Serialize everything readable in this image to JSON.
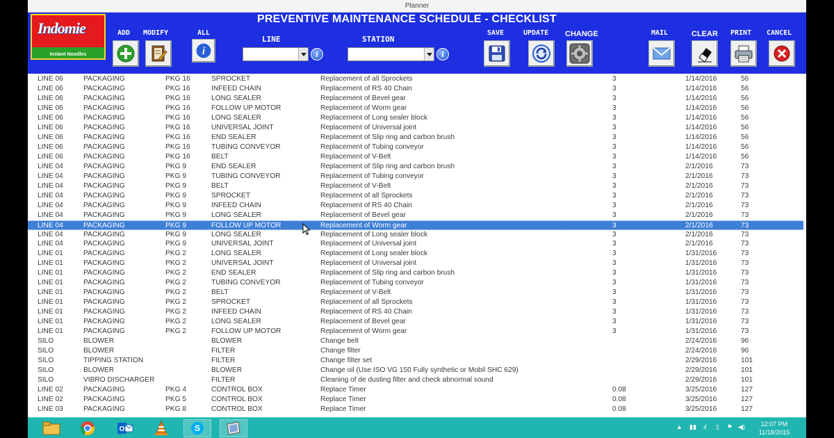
{
  "window": {
    "title": "Planner"
  },
  "header": {
    "app_title": "PREVENTIVE MAINTENANCE SCHEDULE - CHECKLIST",
    "logo_brand": "Indomie",
    "logo_sub": "Instant Noodles",
    "labels": {
      "add": "ADD",
      "modify": "MODIFY",
      "all": "ALL",
      "line": "LINE",
      "station": "STATION",
      "save": "SAVE",
      "update": "UPDATE",
      "change": "CHANGE",
      "mail": "MAIL",
      "clear": "CLEAR",
      "print": "PRINT",
      "cancel": "CANCEL"
    },
    "line_value": "",
    "station_value": ""
  },
  "accent_colors": {
    "toolbar": "#1d2fe0",
    "selection": "#3e7fd6",
    "taskbar": "#21b5b0"
  },
  "rows": [
    [
      "LINE 06",
      "PACKAGING",
      "PKG 16",
      "SPROCKET",
      "Replacement of all Sprockets",
      "3",
      "1/14/2016",
      "56"
    ],
    [
      "LINE 06",
      "PACKAGING",
      "PKG 16",
      "INFEED CHAIN",
      "Replacement of RS 40 Chain",
      "3",
      "1/14/2016",
      "56"
    ],
    [
      "LINE 06",
      "PACKAGING",
      "PKG 16",
      "LONG SEALER",
      "Replacement of Bevel gear",
      "3",
      "1/14/2016",
      "56"
    ],
    [
      "LINE 06",
      "PACKAGING",
      "PKG 16",
      "FOLLOW UP MOTOR",
      "Replacement of Worm gear",
      "3",
      "1/14/2016",
      "56"
    ],
    [
      "LINE 06",
      "PACKAGING",
      "PKG 16",
      "LONG SEALER",
      "Replacement of Long sealer block",
      "3",
      "1/14/2016",
      "56"
    ],
    [
      "LINE 06",
      "PACKAGING",
      "PKG 16",
      "UNIVERSAL JOINT",
      "Replacement of Universal joint",
      "3",
      "1/14/2016",
      "56"
    ],
    [
      "LINE 06",
      "PACKAGING",
      "PKG 16",
      "END SEALER",
      "Replacement of Slip ring and carbon brush",
      "3",
      "1/14/2016",
      "56"
    ],
    [
      "LINE 06",
      "PACKAGING",
      "PKG 16",
      "TUBING CONVEYOR",
      "Replacement of Tubing conveyor",
      "3",
      "1/14/2016",
      "56"
    ],
    [
      "LINE 06",
      "PACKAGING",
      "PKG 16",
      "BELT",
      "Replacement of V-Belt",
      "3",
      "1/14/2016",
      "56"
    ],
    [
      "LINE 04",
      "PACKAGING",
      "PKG 9",
      "END SEALER",
      "Replacement of Slip ring and carbon brush",
      "3",
      "2/1/2016",
      "73"
    ],
    [
      "LINE 04",
      "PACKAGING",
      "PKG 9",
      "TUBING CONVEYOR",
      "Replacement of Tubing conveyor",
      "3",
      "2/1/2016",
      "73"
    ],
    [
      "LINE 04",
      "PACKAGING",
      "PKG 9",
      "BELT",
      "Replacement of V-Belt",
      "3",
      "2/1/2016",
      "73"
    ],
    [
      "LINE 04",
      "PACKAGING",
      "PKG 9",
      "SPROCKET",
      "Replacement of all Sprockets",
      "3",
      "2/1/2016",
      "73"
    ],
    [
      "LINE 04",
      "PACKAGING",
      "PKG 9",
      "INFEED CHAIN",
      "Replacement of RS 40 Chain",
      "3",
      "2/1/2016",
      "73"
    ],
    [
      "LINE 04",
      "PACKAGING",
      "PKG 9",
      "LONG SEALER",
      "Replacement of Bevel gear",
      "3",
      "2/1/2016",
      "73"
    ],
    [
      "LINE 04",
      "PACKAGING",
      "PKG 9",
      "FOLLOW UP MOTOR",
      "Replacement of Worm gear",
      "3",
      "2/1/2016",
      "73"
    ],
    [
      "LINE 04",
      "PACKAGING",
      "PKG 9",
      "LONG SEALER",
      "Replacement of Long sealer block",
      "3",
      "2/1/2016",
      "73"
    ],
    [
      "LINE 04",
      "PACKAGING",
      "PKG 9",
      "UNIVERSAL JOINT",
      "Replacement of Universal joint",
      "3",
      "2/1/2016",
      "73"
    ],
    [
      "LINE 01",
      "PACKAGING",
      "PKG 2",
      "LONG SEALER",
      "Replacement of Long sealer block",
      "3",
      "1/31/2016",
      "73"
    ],
    [
      "LINE 01",
      "PACKAGING",
      "PKG 2",
      "UNIVERSAL JOINT",
      "Replacement of Universal joint",
      "3",
      "1/31/2016",
      "73"
    ],
    [
      "LINE 01",
      "PACKAGING",
      "PKG 2",
      "END SEALER",
      "Replacement of Slip ring and carbon brush",
      "3",
      "1/31/2016",
      "73"
    ],
    [
      "LINE 01",
      "PACKAGING",
      "PKG 2",
      "TUBING CONVEYOR",
      "Replacement of Tubing conveyor",
      "3",
      "1/31/2016",
      "73"
    ],
    [
      "LINE 01",
      "PACKAGING",
      "PKG 2",
      "BELT",
      "Replacement of V-Belt",
      "3",
      "1/31/2016",
      "73"
    ],
    [
      "LINE 01",
      "PACKAGING",
      "PKG 2",
      "SPROCKET",
      "Replacement of all Sprockets",
      "3",
      "1/31/2016",
      "73"
    ],
    [
      "LINE 01",
      "PACKAGING",
      "PKG 2",
      "INFEED CHAIN",
      "Replacement of RS 40 Chain",
      "3",
      "1/31/2016",
      "73"
    ],
    [
      "LINE 01",
      "PACKAGING",
      "PKG 2",
      "LONG SEALER",
      "Replacement of Bevel gear",
      "3",
      "1/31/2016",
      "73"
    ],
    [
      "LINE 01",
      "PACKAGING",
      "PKG 2",
      "FOLLOW UP MOTOR",
      "Replacement of Worm gear",
      "3",
      "1/31/2016",
      "73"
    ],
    [
      "SILO",
      "BLOWER",
      "",
      "BLOWER",
      "Change belt",
      "",
      "2/24/2016",
      "96"
    ],
    [
      "SILO",
      "BLOWER",
      "",
      "FILTER",
      "Change filter",
      "",
      "2/24/2016",
      "96"
    ],
    [
      "SILO",
      "TIPPING STATION",
      "",
      "FILTER",
      "Change filter set",
      "",
      "2/29/2016",
      "101"
    ],
    [
      "SILO",
      "BLOWER",
      "",
      "BLOWER",
      "Change oil (Use ISO VG 150 Fully synthetic or Mobil SHC 629)",
      "",
      "2/29/2016",
      "101"
    ],
    [
      "SILO",
      "VIBRO DISCHARGER",
      "",
      "FILTER",
      "Cleaning of de dusting filter and check abnormal sound",
      "",
      "2/29/2016",
      "101"
    ],
    [
      "LINE 02",
      "PACKAGING",
      "PKG 4",
      "CONTROL BOX",
      "Replace Timer",
      "0.08",
      "3/25/2016",
      "127"
    ],
    [
      "LINE 02",
      "PACKAGING",
      "PKG 5",
      "CONTROL BOX",
      "Replace Timer",
      "0.08",
      "3/25/2016",
      "127"
    ],
    [
      "LINE 03",
      "PACKAGING",
      "PKG 8",
      "CONTROL BOX",
      "Replace Timer",
      "0.08",
      "3/25/2016",
      "127"
    ]
  ],
  "selected_row_index": 15,
  "taskbar": {
    "icons": [
      "file-explorer-icon",
      "chrome-icon",
      "outlook-icon",
      "vlc-icon",
      "skype-icon",
      "planner-icon"
    ],
    "time": "12:07 PM",
    "date": "11/18/2015"
  }
}
